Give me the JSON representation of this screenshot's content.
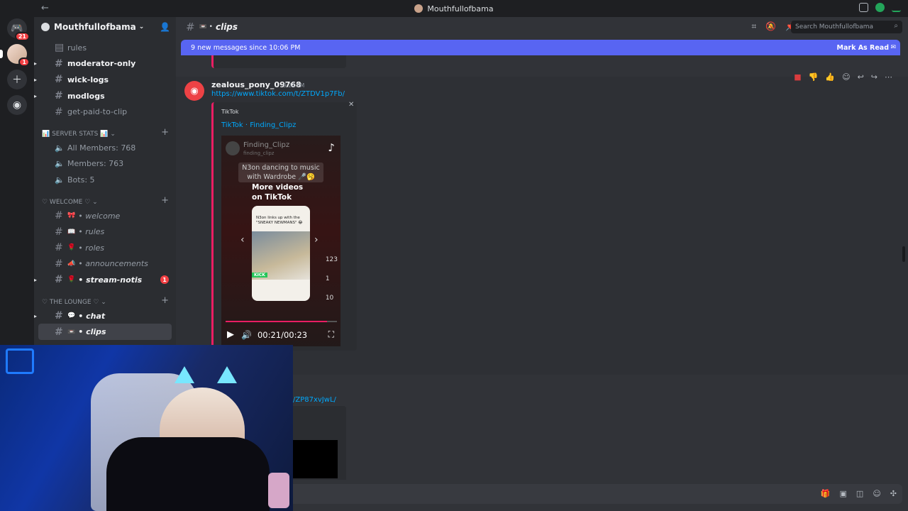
{
  "titlebar": {
    "title": "Mouthfullofbama"
  },
  "servers": {
    "home_badge": "21",
    "user_badge": "1"
  },
  "sidebar": {
    "guild_name": "Mouthfullofbama",
    "channels_top": [
      {
        "label": "rules",
        "bold": false
      },
      {
        "label": "moderator-only",
        "bold": true
      },
      {
        "label": "wick-logs",
        "bold": true
      },
      {
        "label": "modlogs",
        "bold": true
      },
      {
        "label": "get-paid-to-clip",
        "bold": false
      }
    ],
    "cat_stats": "SERVER STATS",
    "stats": [
      "All Members: 768",
      "Members: 763",
      "Bots: 5"
    ],
    "cat_welcome": "♡ WELCOME ♡",
    "welcome_channels": [
      {
        "emoji": "🎀",
        "label": "welcome"
      },
      {
        "emoji": "📖",
        "label": "rules"
      },
      {
        "emoji": "🌹",
        "label": "roles"
      },
      {
        "emoji": "📣",
        "label": "announcements"
      },
      {
        "emoji": "🌹",
        "label": "stream-notis",
        "mention": "1"
      }
    ],
    "cat_lounge": "♡ THE LOUNGE ♡",
    "lounge_channels": [
      {
        "emoji": "💬",
        "label": "chat"
      },
      {
        "emoji": "📼",
        "label": "clips"
      }
    ]
  },
  "channel": {
    "name": "clips",
    "search_placeholder": "Search Mouthfullofbama"
  },
  "newbar": {
    "text": "9 new messages since 10:06 PM",
    "mark": "Mark As Read"
  },
  "message": {
    "author": "zealous_pony_09768",
    "time": "9:24 PM",
    "link": "https://www.tiktok.com/t/ZTDV1p7Fb/",
    "embed": {
      "provider": "TikTok",
      "title": "TikTok · Finding_Clipz",
      "video": {
        "channel": "Finding_Clipz",
        "handle": "finding_clipz",
        "caption": "N3on dancing to music with Wardrobe 🎤🥱",
        "more": "More videos on TikTok",
        "card_text": "N3on links up with the \"SNEAKY NEWMANS\" 😂",
        "card_tag": "KICK",
        "counts": [
          "123",
          "1",
          "10"
        ],
        "time": "00:21/00:23",
        "progress": 0.91
      }
    }
  },
  "message2": {
    "link": "/ZP87xvJwL/"
  },
  "colors": {
    "accent": "#5865f2",
    "embed_border": "#e91e63",
    "link": "#00a8fc",
    "mention": "#f23f43"
  }
}
